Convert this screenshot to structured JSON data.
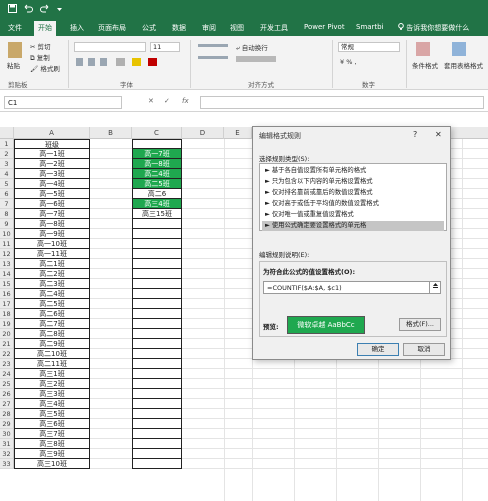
{
  "qat": {
    "save_icon": "save-icon",
    "undo_icon": "undo-icon",
    "redo_icon": "redo-icon",
    "customize_icon": "customize-icon"
  },
  "tabs": [
    "文件",
    "开始",
    "插入",
    "页面布局",
    "公式",
    "数据",
    "审阅",
    "视图",
    "开发工具",
    "Power Pivot",
    "Smartbi"
  ],
  "tell_me": "告诉我你想要做什么",
  "ribbon": {
    "paste": "粘贴",
    "cut": "剪切",
    "copy": "复制",
    "format_painter": "格式刷",
    "font_size": "11",
    "wrap_text": "自动换行",
    "number_format": "常规",
    "conditional_format": "条件格式",
    "table_format": "套用表格格式",
    "groups": {
      "clipboard": "剪贴板",
      "font": "字体",
      "alignment": "对齐方式",
      "number": "数字"
    }
  },
  "namebox": "C1",
  "formula_bar": {
    "cancel": "✕",
    "enter": "✓",
    "fx": "fx"
  },
  "columns": [
    "A",
    "B",
    "C",
    "D",
    "E"
  ],
  "rows": [
    {
      "n": "1",
      "a": "班级",
      "c": "",
      "c_green": false
    },
    {
      "n": "2",
      "a": "高一1班",
      "c": "高一7班",
      "c_green": true
    },
    {
      "n": "3",
      "a": "高一2班",
      "c": "高一8班",
      "c_green": true
    },
    {
      "n": "4",
      "a": "高一3班",
      "c": "高二4班",
      "c_green": true
    },
    {
      "n": "5",
      "a": "高一4班",
      "c": "高二5班",
      "c_green": true
    },
    {
      "n": "6",
      "a": "高一5班",
      "c": "高二6",
      "c_green": false
    },
    {
      "n": "7",
      "a": "高一6班",
      "c": "高三4班",
      "c_green": true
    },
    {
      "n": "8",
      "a": "高一7班",
      "c": "高三15班",
      "c_green": false
    },
    {
      "n": "9",
      "a": "高一8班",
      "c": "",
      "c_green": false
    },
    {
      "n": "10",
      "a": "高一9班",
      "c": "",
      "c_green": false
    },
    {
      "n": "11",
      "a": "高一10班",
      "c": "",
      "c_green": false
    },
    {
      "n": "12",
      "a": "高一11班",
      "c": "",
      "c_green": false
    },
    {
      "n": "13",
      "a": "高二1班",
      "c": "",
      "c_green": false
    },
    {
      "n": "14",
      "a": "高二2班",
      "c": "",
      "c_green": false
    },
    {
      "n": "15",
      "a": "高二3班",
      "c": "",
      "c_green": false
    },
    {
      "n": "16",
      "a": "高二4班",
      "c": "",
      "c_green": false
    },
    {
      "n": "17",
      "a": "高二5班",
      "c": "",
      "c_green": false
    },
    {
      "n": "18",
      "a": "高二6班",
      "c": "",
      "c_green": false
    },
    {
      "n": "19",
      "a": "高二7班",
      "c": "",
      "c_green": false
    },
    {
      "n": "20",
      "a": "高二8班",
      "c": "",
      "c_green": false
    },
    {
      "n": "21",
      "a": "高二9班",
      "c": "",
      "c_green": false
    },
    {
      "n": "22",
      "a": "高二10班",
      "c": "",
      "c_green": false
    },
    {
      "n": "23",
      "a": "高二11班",
      "c": "",
      "c_green": false
    },
    {
      "n": "24",
      "a": "高三1班",
      "c": "",
      "c_green": false
    },
    {
      "n": "25",
      "a": "高三2班",
      "c": "",
      "c_green": false
    },
    {
      "n": "26",
      "a": "高三3班",
      "c": "",
      "c_green": false
    },
    {
      "n": "27",
      "a": "高三4班",
      "c": "",
      "c_green": false
    },
    {
      "n": "28",
      "a": "高三5班",
      "c": "",
      "c_green": false
    },
    {
      "n": "29",
      "a": "高三6班",
      "c": "",
      "c_green": false
    },
    {
      "n": "30",
      "a": "高三7班",
      "c": "",
      "c_green": false
    },
    {
      "n": "31",
      "a": "高三8班",
      "c": "",
      "c_green": false
    },
    {
      "n": "32",
      "a": "高三9班",
      "c": "",
      "c_green": false
    },
    {
      "n": "33",
      "a": "高三10班",
      "c": "",
      "c_green": false
    }
  ],
  "dialog": {
    "title": "编辑格式规则",
    "help": "?",
    "close": "✕",
    "select_type_label": "选择规则类型(S):",
    "rule_types": [
      "► 基于各自值设置所有单元格的格式",
      "► 只为包含以下内容的单元格设置格式",
      "► 仅对排名靠前或靠后的数值设置格式",
      "► 仅对高于或低于平均值的数值设置格式",
      "► 仅对唯一值或重复值设置格式",
      "► 使用公式确定要设置格式的单元格"
    ],
    "selected_rule_index": 5,
    "edit_desc_label": "编辑规则说明(E):",
    "formula_label": "为符合此公式的值设置格式(O):",
    "formula_value": "=COUNTIF($A:$A, $c1)",
    "collapse_icon": "collapse-dialog-icon",
    "preview_label": "预览:",
    "preview_text": "微软卓越 AaBbCc",
    "preview_color": "#1fa84f",
    "format_button": "格式(F)...",
    "ok_button": "确定",
    "cancel_button": "取消"
  },
  "colors": {
    "ribbon_green": "#217346",
    "highlight_green": "#1fa84f"
  }
}
